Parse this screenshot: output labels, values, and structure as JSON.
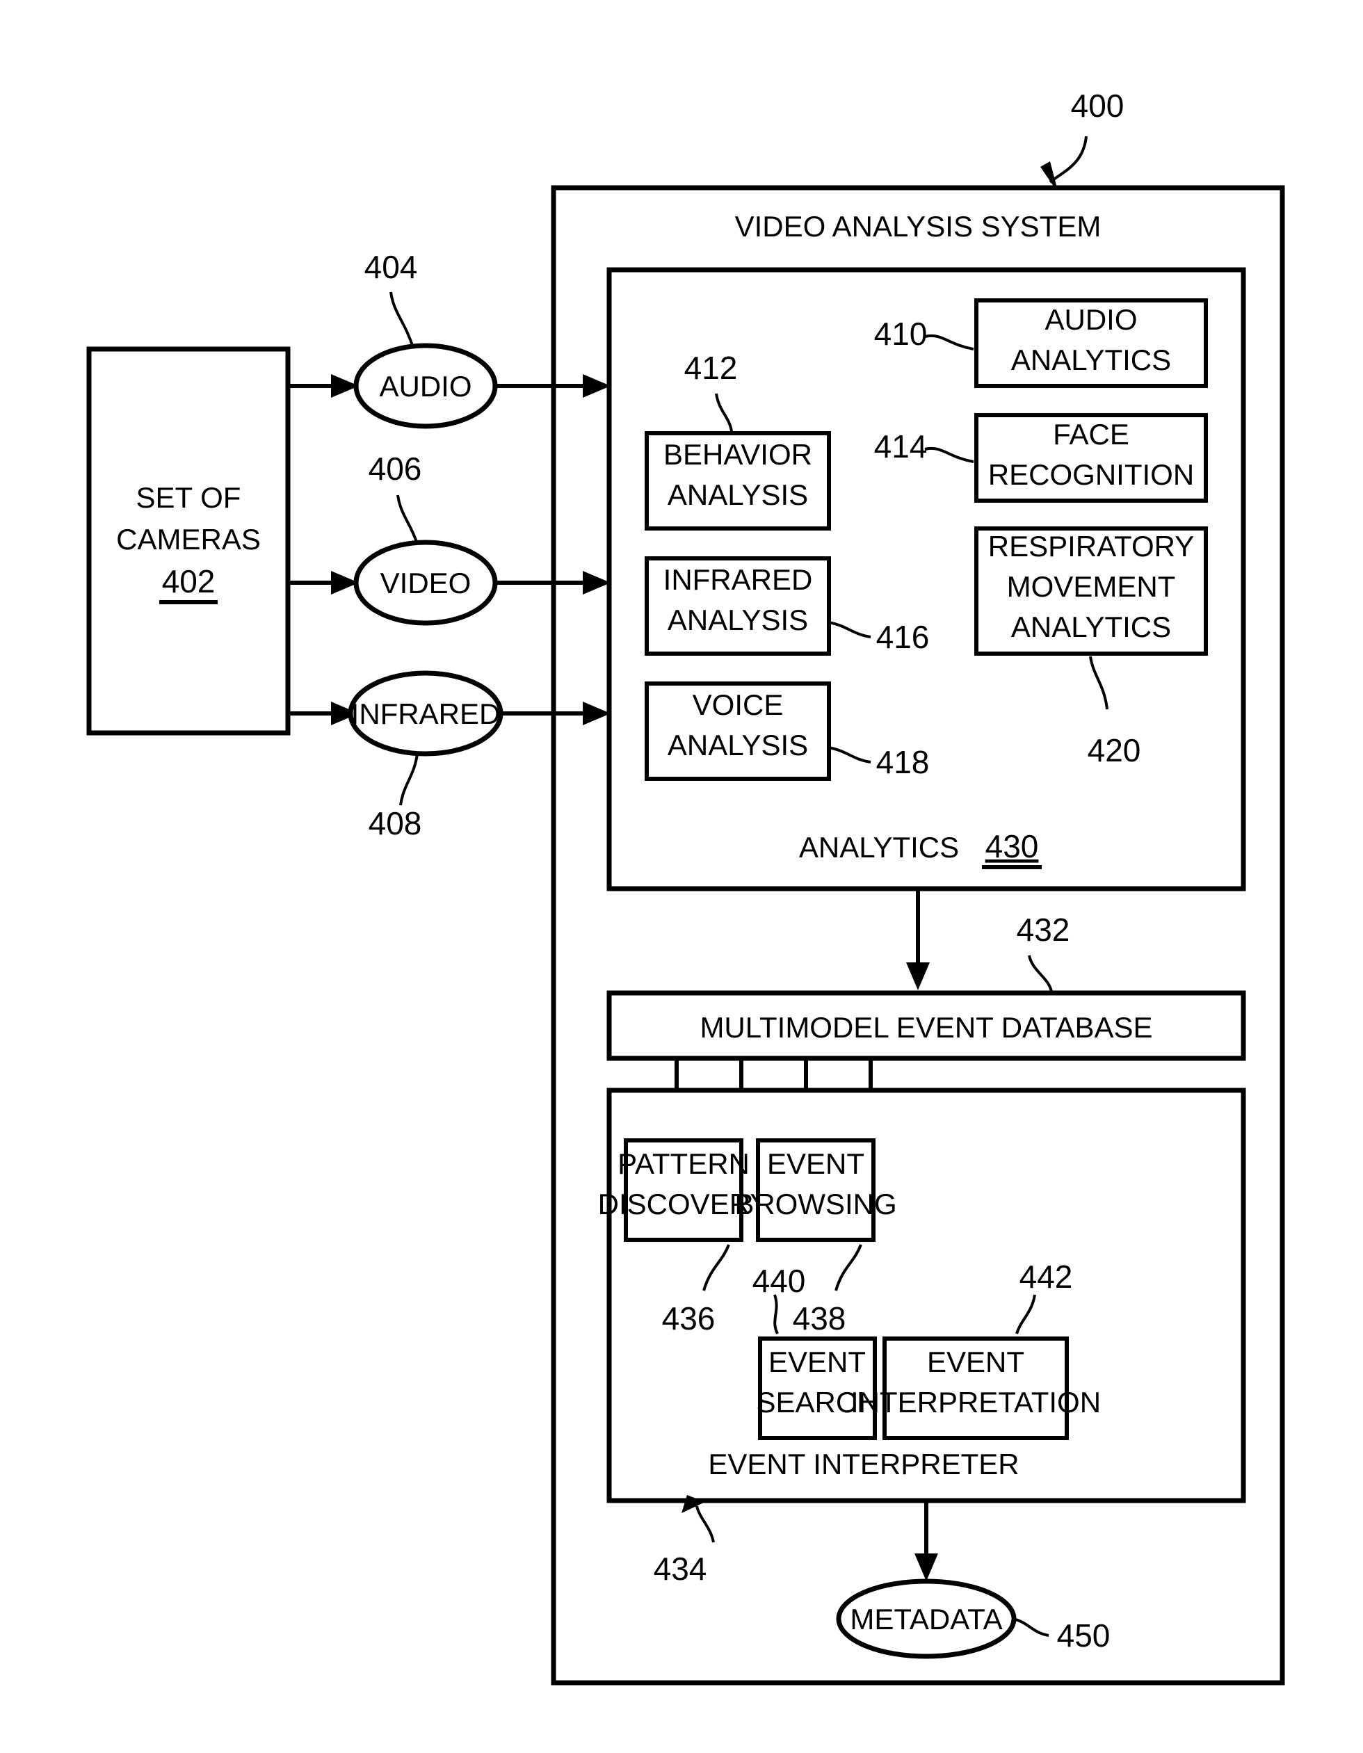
{
  "figure": {
    "system_title": "VIDEO ANALYSIS SYSTEM",
    "system_ref": "400",
    "source_block": {
      "label_line1": "SET OF",
      "label_line2": "CAMERAS",
      "ref": "402"
    },
    "input_streams": [
      {
        "label": "AUDIO",
        "ref": "404"
      },
      {
        "label": "VIDEO",
        "ref": "406"
      },
      {
        "label": "INFRARED",
        "ref": "408"
      }
    ],
    "analytics_section": {
      "label": "ANALYTICS",
      "ref": "430",
      "modules_left": [
        {
          "line1": "BEHAVIOR",
          "line2": "ANALYSIS",
          "ref": "412"
        },
        {
          "line1": "INFRARED",
          "line2": "ANALYSIS",
          "ref": "416"
        },
        {
          "line1": "VOICE",
          "line2": "ANALYSIS",
          "ref": "418"
        }
      ],
      "modules_right": [
        {
          "line1": "AUDIO",
          "line2": "ANALYTICS",
          "line3": "",
          "ref": "410"
        },
        {
          "line1": "FACE",
          "line2": "RECOGNITION",
          "line3": "",
          "ref": "414"
        },
        {
          "line1": "RESPIRATORY",
          "line2": "MOVEMENT",
          "line3": "ANALYTICS",
          "ref": "420"
        }
      ]
    },
    "database": {
      "label": "MULTIMODEL EVENT DATABASE",
      "ref": "432"
    },
    "interpreter_section": {
      "label": "EVENT INTERPRETER",
      "ref": "434",
      "modules": [
        {
          "line1": "PATTERN",
          "line2": "DISCOVERY",
          "ref": "436"
        },
        {
          "line1": "EVENT",
          "line2": "BROWSING",
          "ref": "438"
        },
        {
          "line1": "EVENT",
          "line2": "SEARCH",
          "ref": "440"
        },
        {
          "line1": "EVENT",
          "line2": "INTERPRETATION",
          "ref": "442"
        }
      ]
    },
    "output": {
      "label": "METADATA",
      "ref": "450"
    },
    "colors": {
      "stroke": "#000000",
      "fill": "#ffffff"
    }
  }
}
